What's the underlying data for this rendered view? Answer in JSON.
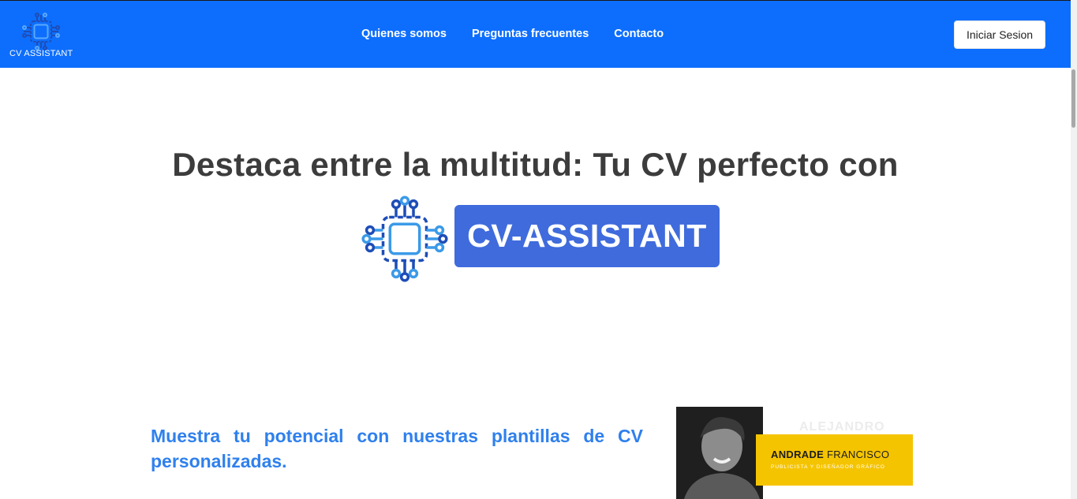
{
  "navbar": {
    "brand_text": "CV ASSISTANT",
    "links": [
      {
        "label": "Quienes somos"
      },
      {
        "label": "Preguntas frecuentes"
      },
      {
        "label": "Contacto"
      }
    ],
    "login_label": "Iniciar Sesion"
  },
  "hero": {
    "title": "Destaca entre la multitud: Tu CV perfecto con",
    "badge": "CV-ASSISTANT"
  },
  "feature": {
    "text": "Muestra tu potencial con nuestras plantillas de CV personalizadas."
  },
  "cv_preview": {
    "faded_name": "ALEJANDRO",
    "first_name": "ANDRADE",
    "last_name": "FRANCISCO",
    "role": "PUBLICISTA Y DISEÑADOR GRÁFICO"
  },
  "colors": {
    "navbar": "#0d6efd",
    "badge": "#3f6bdc",
    "feature_text": "#2f80ed",
    "cv_card": "#f5c400"
  },
  "icons": {
    "logo": "chip-circuit-icon"
  }
}
